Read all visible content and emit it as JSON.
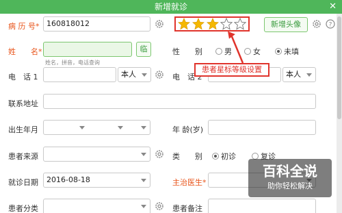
{
  "window": {
    "title": "新增就诊",
    "close_glyph": "✕"
  },
  "fields": {
    "case_no": {
      "label": "病 历 号*",
      "value": "160818012"
    },
    "name": {
      "label": "姓　　名*",
      "value": "",
      "hint": "姓名，拼音，电话查询",
      "search_btn": "临"
    },
    "gender": {
      "label": "性　　别",
      "options": [
        "男",
        "女",
        "未填"
      ],
      "selected": "未填"
    },
    "phone1": {
      "label": "电　话 1",
      "value": "",
      "relation": "本人"
    },
    "phone2": {
      "label": "电　话 2",
      "value": "",
      "relation": "本人"
    },
    "address": {
      "label": "联系地址",
      "value": ""
    },
    "birth": {
      "label": "出生年月",
      "value": ""
    },
    "age": {
      "label": "年 龄(岁)",
      "value": ""
    },
    "source": {
      "label": "患者来源",
      "value": ""
    },
    "visit_type": {
      "label": "类　　别",
      "options": [
        "初诊",
        "复诊"
      ],
      "selected": "初诊"
    },
    "visit_date": {
      "label": "就诊日期",
      "value": "2016-08-18"
    },
    "doctor": {
      "label": "主治医生*",
      "value": ""
    },
    "category": {
      "label": "患者分类",
      "value": ""
    },
    "remark": {
      "label": "患者备注",
      "value": ""
    }
  },
  "rating": {
    "stars_total": 5,
    "stars_filled": 3
  },
  "avatar_button": "新增头像",
  "annotation": "患者星标等级设置",
  "watermark": {
    "title": "百科全说",
    "subtitle": "助你轻松解决"
  },
  "colors": {
    "title_bar": "#4fb65a",
    "required_label": "#e8541a",
    "star": "#f5b800",
    "annotation": "#e0332b"
  }
}
